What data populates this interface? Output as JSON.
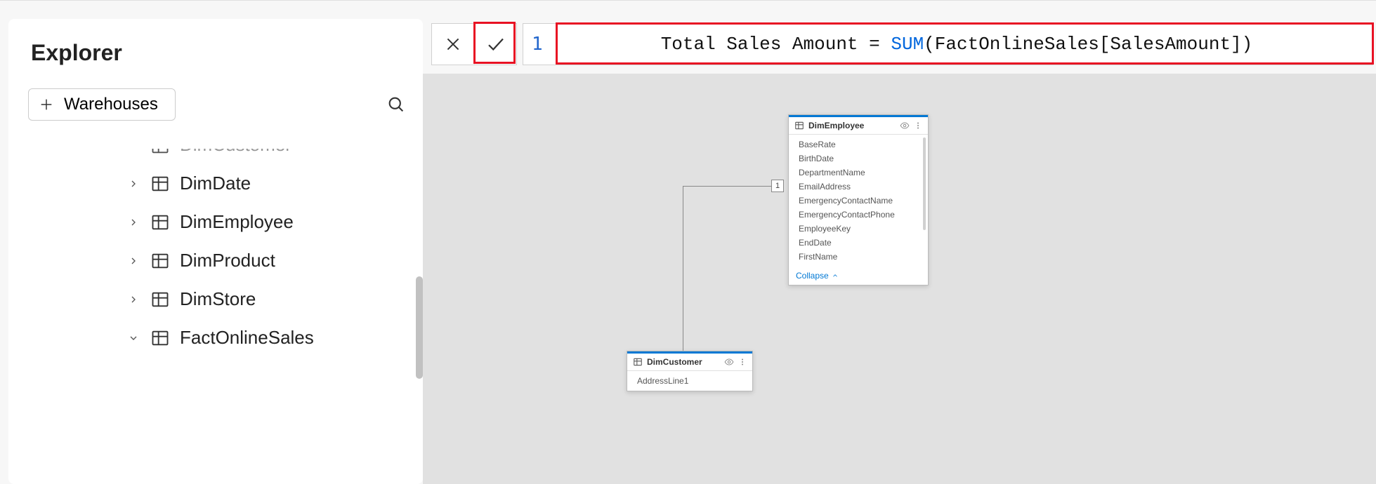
{
  "sidebar": {
    "title": "Explorer",
    "warehouses_button": "Warehouses",
    "cutoff_item": "DimCustomer",
    "items": [
      {
        "label": "DimDate",
        "expanded": false
      },
      {
        "label": "DimEmployee",
        "expanded": false
      },
      {
        "label": "DimProduct",
        "expanded": false
      },
      {
        "label": "DimStore",
        "expanded": false
      },
      {
        "label": "FactOnlineSales",
        "expanded": true
      }
    ]
  },
  "formula_bar": {
    "line_number": "1",
    "tokens": {
      "measure_name": "Total Sales Amount",
      "equals": " = ",
      "func": "SUM",
      "open": "(",
      "ref": "FactOnlineSales[SalesAmount]",
      "close": ")"
    }
  },
  "relationship_badge": "1",
  "entity_employee": {
    "title": "DimEmployee",
    "fields": [
      "BaseRate",
      "BirthDate",
      "DepartmentName",
      "EmailAddress",
      "EmergencyContactName",
      "EmergencyContactPhone",
      "EmployeeKey",
      "EndDate",
      "FirstName"
    ],
    "collapse": "Collapse"
  },
  "entity_customer": {
    "title": "DimCustomer",
    "fields": [
      "AddressLine1"
    ]
  }
}
